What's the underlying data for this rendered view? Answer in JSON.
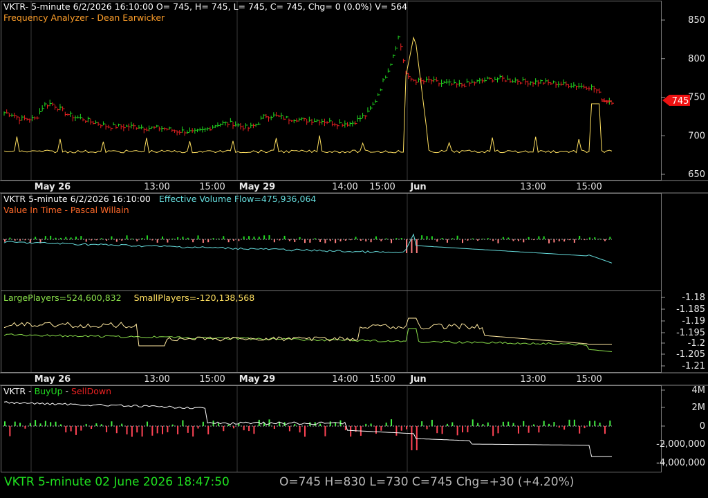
{
  "colors": {
    "up": "#22dd22",
    "down": "#ee2222",
    "yellow": "#ffe060",
    "cyan": "#66dddd",
    "green": "#8ae04a",
    "orange": "#ff7f2a",
    "white": "#ffffff",
    "grid": "#3a3a3a"
  },
  "panel1": {
    "header": "VKTR- 5-minute 6/2/2026 16:10:00 O= 745, H= 745, L= 745, C= 745, Chg= 0 (0.0%) V= 564",
    "indicator": "Frequency Analyzer - Dean Earwicker",
    "price_tag": "745",
    "y_ticks": [
      "850",
      "800",
      "750",
      "700",
      "650"
    ]
  },
  "xaxis": {
    "labels": [
      {
        "text": "May 26",
        "bold": true
      },
      {
        "text": "13:00",
        "bold": false
      },
      {
        "text": "15:00",
        "bold": false
      },
      {
        "text": "May 29",
        "bold": true
      },
      {
        "text": "14:00",
        "bold": false
      },
      {
        "text": "15:00",
        "bold": false
      },
      {
        "text": "Jun",
        "bold": true
      },
      {
        "text": "13:00",
        "bold": false
      },
      {
        "text": "15:00",
        "bold": false
      }
    ]
  },
  "panel2": {
    "header_symbol": "VKTR 5-minute  6/2/2026 16:10:00",
    "header_indicator": "Effective Volume Flow=475,936,064",
    "indicator": "Value In Time - Pascal Willain"
  },
  "panel3": {
    "large": "LargePlayers=524,600,832",
    "small": "SmallPlayers=-120,138,568",
    "y_ticks": [
      "-1.18",
      "-1.185",
      "-1.19",
      "-1.195",
      "-1.2",
      "-1.205",
      "-1.21"
    ]
  },
  "panel4": {
    "prefix": "VKTR - ",
    "buy": "BuyUp",
    "dash": "-",
    "sell": "SellDown",
    "y_ticks": [
      "4M",
      "2M",
      "0",
      "-2,000,000",
      "-4,000,000"
    ]
  },
  "status": {
    "left": "VKTR  5-minute   02 June 2026 18:47:50",
    "right": "O=745  H=830  L=730  C=745  Chg=+30 (+4.20%)"
  },
  "chart_data": [
    {
      "type": "line",
      "title": "Frequency Analyzer - Dean Earwicker",
      "ylim": [
        640,
        860
      ],
      "series": [
        {
          "name": "",
          "values": [
            730,
            728,
            722,
            722,
            722,
            740,
            742,
            735,
            728,
            724,
            722,
            718,
            716,
            712,
            712,
            712,
            712,
            712,
            710,
            710,
            710,
            708,
            706,
            706,
            704,
            706,
            710,
            715,
            716,
            716,
            712,
            710,
            715,
            726,
            726,
            724,
            722,
            722,
            720,
            720,
            720,
            718,
            716,
            716,
            716,
            722,
            728,
            745,
            770,
            795,
            830,
            775,
            772,
            770,
            772,
            768,
            768,
            766,
            766,
            768,
            770,
            772,
            774,
            774,
            772,
            772,
            770,
            770,
            770,
            768,
            768,
            766,
            766,
            764,
            764,
            760,
            745,
            745
          ]
        }
      ]
    },
    {
      "type": "line",
      "title": "Value In Time - Pascal Willain",
      "series": [
        {
          "name": "Effective Volume Flow",
          "values": [
            475936064
          ]
        }
      ]
    },
    {
      "type": "line",
      "ylim": [
        -1.212,
        -1.178
      ],
      "series": [
        {
          "name": "LargePlayers",
          "values": [
            524600832
          ]
        },
        {
          "name": "SmallPlayers",
          "values": [
            -120138568
          ]
        }
      ]
    },
    {
      "type": "bar",
      "ylim": [
        -4200000,
        4600000
      ],
      "series": [
        {
          "name": "BuyUp",
          "values": []
        },
        {
          "name": "SellDown",
          "values": []
        }
      ]
    }
  ]
}
